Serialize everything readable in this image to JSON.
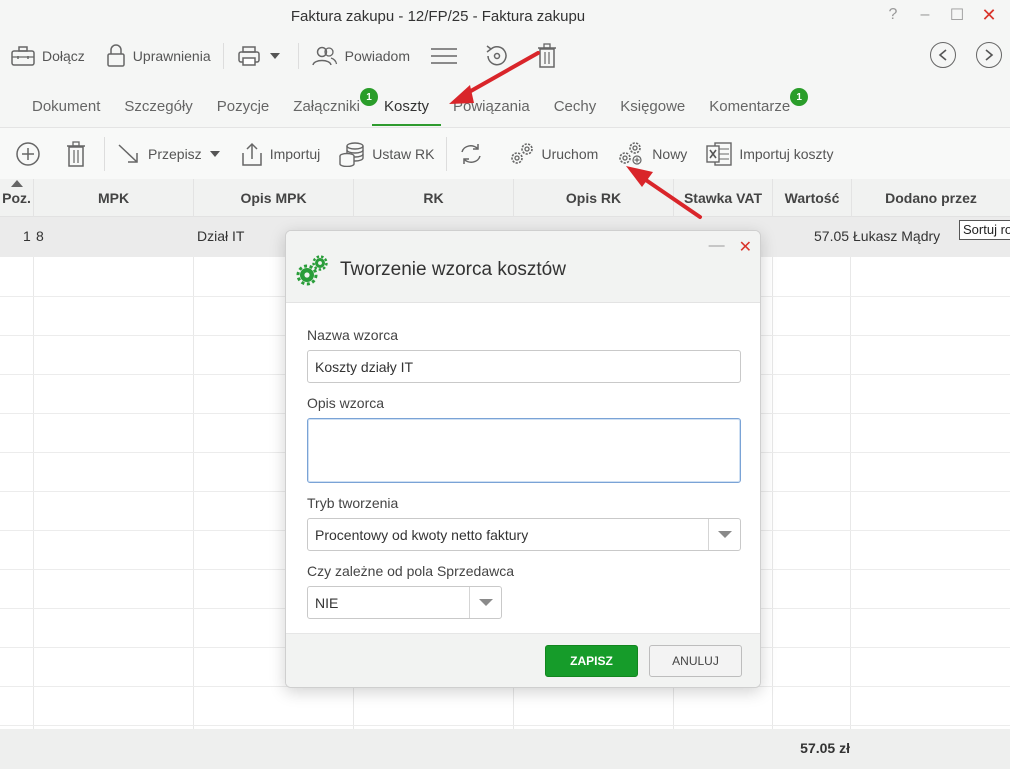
{
  "window": {
    "title": "Faktura zakupu - 12/FP/25 - Faktura zakupu",
    "help": "?",
    "minimize": "–",
    "maximize": "☐",
    "close": "✕"
  },
  "toolbar": {
    "attach": "Dołącz",
    "permissions": "Uprawnienia",
    "notify": "Powiadom"
  },
  "tabs": [
    {
      "label": "Dokument"
    },
    {
      "label": "Szczegóły"
    },
    {
      "label": "Pozycje"
    },
    {
      "label": "Załączniki",
      "badge": "1"
    },
    {
      "label": "Koszty"
    },
    {
      "label": "Powiązania"
    },
    {
      "label": "Cechy"
    },
    {
      "label": "Księgowe"
    },
    {
      "label": "Komentarze",
      "badge": "1"
    }
  ],
  "subtoolbar": {
    "rewrite": "Przepisz",
    "import": "Importuj",
    "set_rk": "Ustaw RK",
    "run": "Uruchom",
    "new": "Nowy",
    "import_costs": "Importuj koszty"
  },
  "grid": {
    "headers": [
      "Poz.",
      "MPK",
      "Opis MPK",
      "RK",
      "Opis RK",
      "Stawka VAT",
      "Wartość",
      "Dodano przez"
    ],
    "row": {
      "poz": "1",
      "mpk": "8",
      "opis_mpk": "Dział IT",
      "wartosc": "57.05",
      "dodano": "Łukasz Mądry"
    },
    "sort_label": "Sortuj rosnąco",
    "total": "57.05 zł"
  },
  "dialog": {
    "title": "Tworzenie wzorca kosztów",
    "name_label": "Nazwa wzorca",
    "name_value": "Koszty działy IT",
    "desc_label": "Opis wzorca",
    "desc_value": "",
    "mode_label": "Tryb tworzenia",
    "mode_value": "Procentowy od kwoty netto faktury",
    "depends_label": "Czy zależne od pola Sprzedawca",
    "depends_value": "NIE",
    "save": "ZAPISZ",
    "cancel": "ANULUJ",
    "minimize": "—",
    "close": "✕"
  },
  "colors": {
    "accent_green": "#169c2a",
    "annotation_red": "#d9252a",
    "tab_underline": "#2e9b2e"
  }
}
